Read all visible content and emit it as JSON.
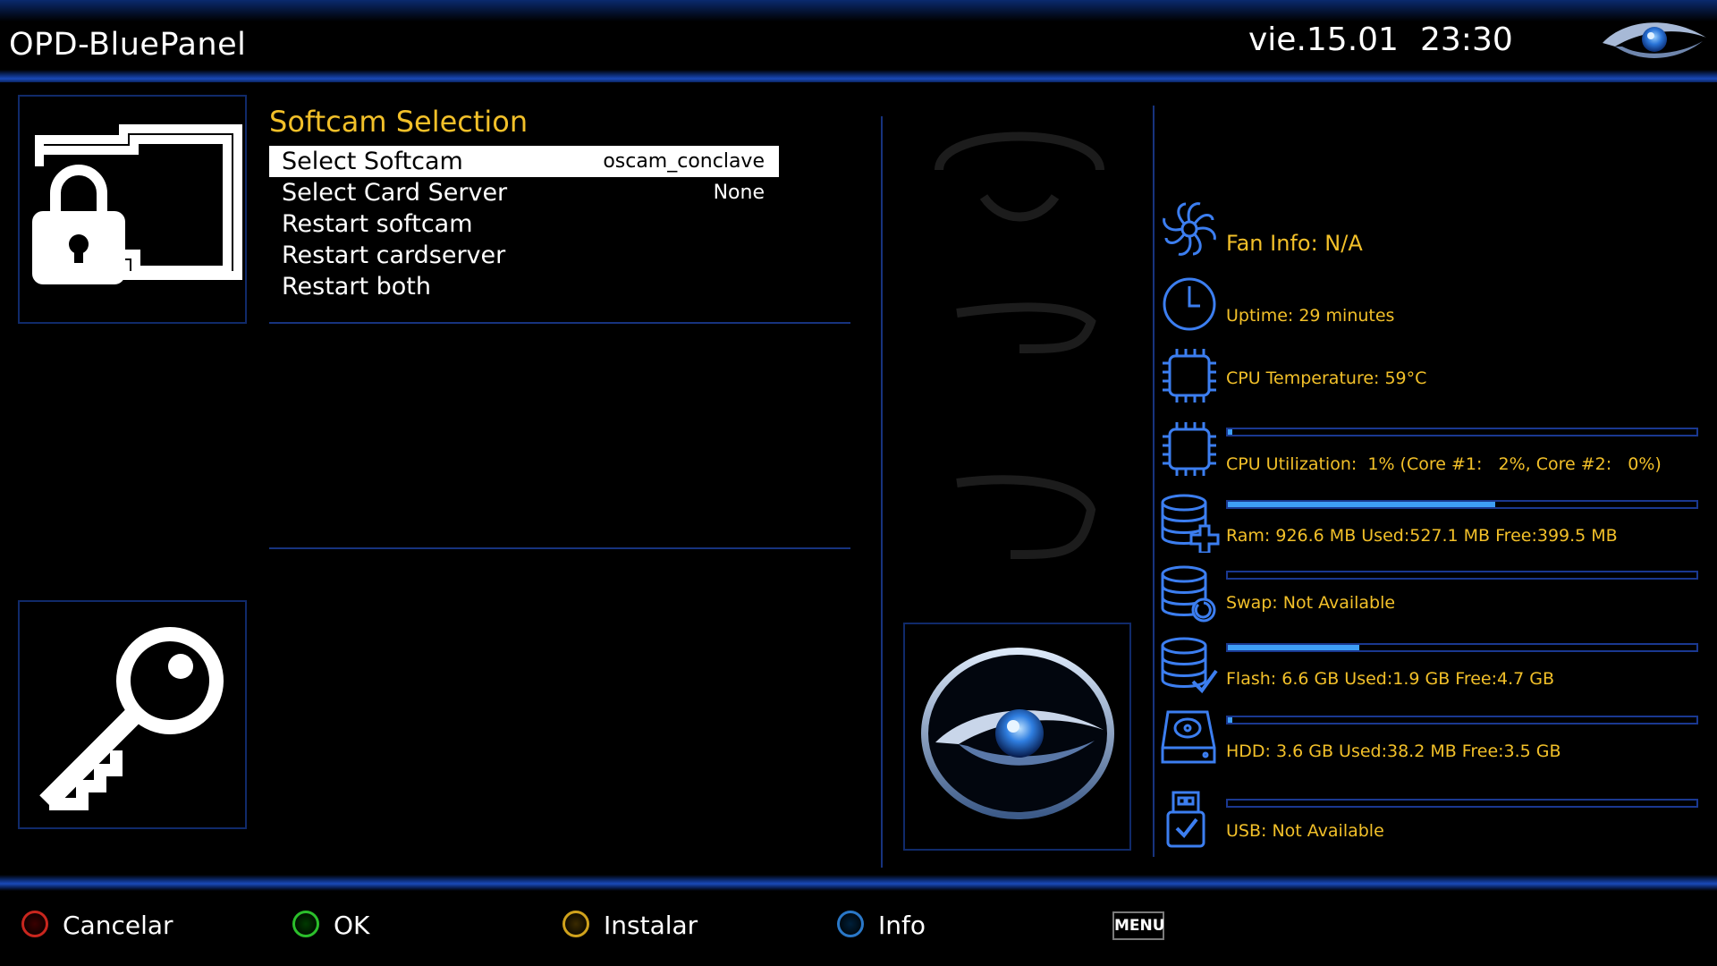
{
  "header": {
    "title": "OPD-BluePanel",
    "date": "vie.15.01",
    "time": "23:30"
  },
  "menu": {
    "title": "Softcam Selection",
    "items": [
      {
        "label": "Select Softcam",
        "value": "oscam_conclave",
        "selected": true
      },
      {
        "label": "Select Card Server",
        "value": "None",
        "selected": false
      },
      {
        "label": "Restart softcam",
        "value": "",
        "selected": false
      },
      {
        "label": "Restart cardserver",
        "value": "",
        "selected": false
      },
      {
        "label": "Restart both",
        "value": "",
        "selected": false
      }
    ]
  },
  "info": {
    "fan": "Fan Info: N/A",
    "uptime": "Uptime: 29 minutes",
    "cpu_temp": "CPU Temperature: 59°C",
    "cpu_util": "CPU Utilization:  1% (Core #1:   2%, Core #2:   0%)",
    "cpu_util_level": 0.01,
    "ram": "Ram: 926.6 MB Used:527.1 MB Free:399.5 MB",
    "ram_level": 0.57,
    "swap": "Swap: Not Available",
    "swap_level": 0.0,
    "flash": "Flash: 6.6 GB Used:1.9 GB Free:4.7 GB",
    "flash_level": 0.28,
    "hdd": "HDD: 3.6 GB Used:38.2 MB Free:3.5 GB",
    "hdd_level": 0.01,
    "usb": "USB: Not Available",
    "usb_level": 0.0
  },
  "footer": {
    "red_label": "Cancelar",
    "green_label": "OK",
    "yellow_label": "Instalar",
    "blue_label": "Info",
    "menu_key": "MENU"
  },
  "colors": {
    "accent_yellow": "#f2c029",
    "bar_fill": "#3e9ef6",
    "border_blue": "#102a6a"
  },
  "icons": [
    "lock-icon",
    "key-icon",
    "eye-logo-icon",
    "fan-icon",
    "clock-icon",
    "cpu-chip-icon",
    "ram-database-icon",
    "swap-database-icon",
    "flash-database-icon",
    "hdd-drive-icon",
    "usb-stick-icon"
  ]
}
